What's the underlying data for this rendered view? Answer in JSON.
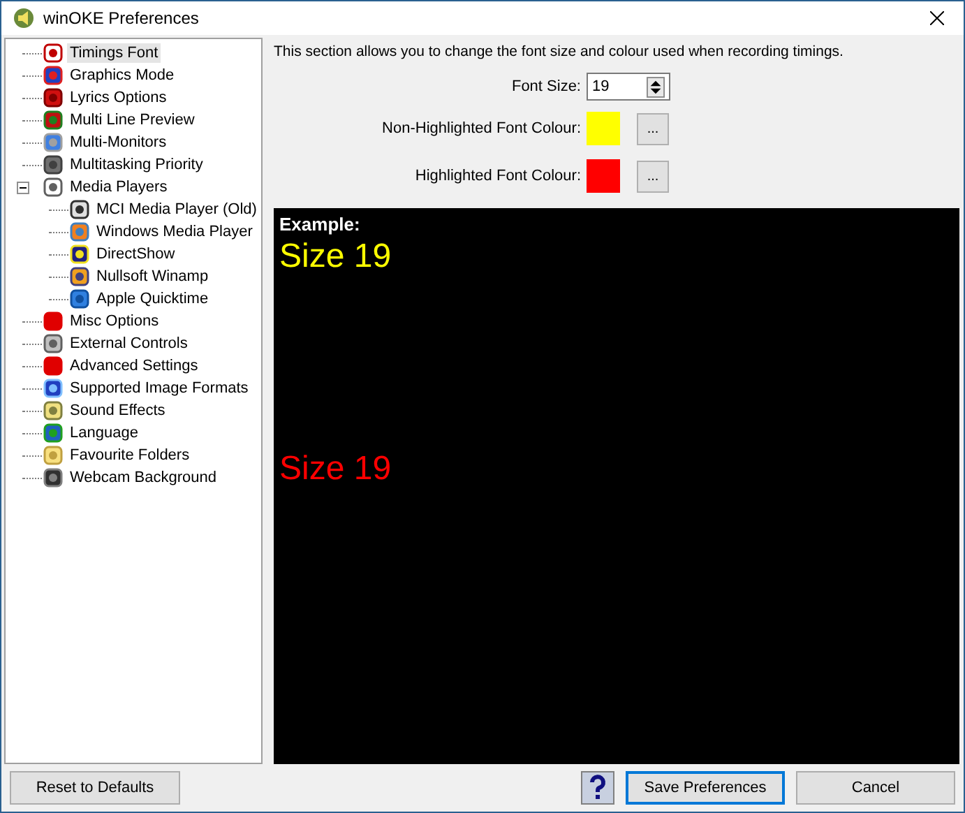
{
  "window": {
    "title": "winOKE Preferences"
  },
  "tree": [
    {
      "label": "Timings Font",
      "selected": true
    },
    {
      "label": "Graphics Mode",
      "selected": false
    },
    {
      "label": "Lyrics Options",
      "selected": false
    },
    {
      "label": "Multi Line Preview",
      "selected": false
    },
    {
      "label": "Multi-Monitors",
      "selected": false
    },
    {
      "label": "Multitasking Priority",
      "selected": false
    },
    {
      "label": "Media Players",
      "selected": false,
      "expanded": true,
      "children": [
        {
          "label": "MCI Media Player (Old)",
          "selected": false
        },
        {
          "label": "Windows Media Player",
          "selected": false
        },
        {
          "label": "DirectShow",
          "selected": false
        },
        {
          "label": "Nullsoft Winamp",
          "selected": false
        },
        {
          "label": "Apple Quicktime",
          "selected": false
        }
      ]
    },
    {
      "label": "Misc Options",
      "selected": false
    },
    {
      "label": "External Controls",
      "selected": false
    },
    {
      "label": "Advanced Settings",
      "selected": false
    },
    {
      "label": "Supported Image Formats",
      "selected": false
    },
    {
      "label": "Sound Effects",
      "selected": false
    },
    {
      "label": "Language",
      "selected": false
    },
    {
      "label": "Favourite Folders",
      "selected": false
    },
    {
      "label": "Webcam Background",
      "selected": false
    }
  ],
  "description": "This section allows you to change the font size and colour used when recording timings.",
  "font_size": {
    "label": "Font Size:",
    "value": "19"
  },
  "colours": [
    {
      "label": "Non-Highlighted Font Colour:",
      "color": "#ffff00",
      "button": "..."
    },
    {
      "label": "Highlighted Font Colour:",
      "color": "#ff0000",
      "button": "..."
    }
  ],
  "preview": {
    "heading": "Example:",
    "lines": [
      {
        "text": "Size 19",
        "color": "#ffff00"
      },
      {
        "text": "Size 19",
        "color": "#ff0000"
      }
    ]
  },
  "buttons": {
    "reset": "Reset to Defaults",
    "save": "Save Preferences",
    "cancel": "Cancel"
  }
}
